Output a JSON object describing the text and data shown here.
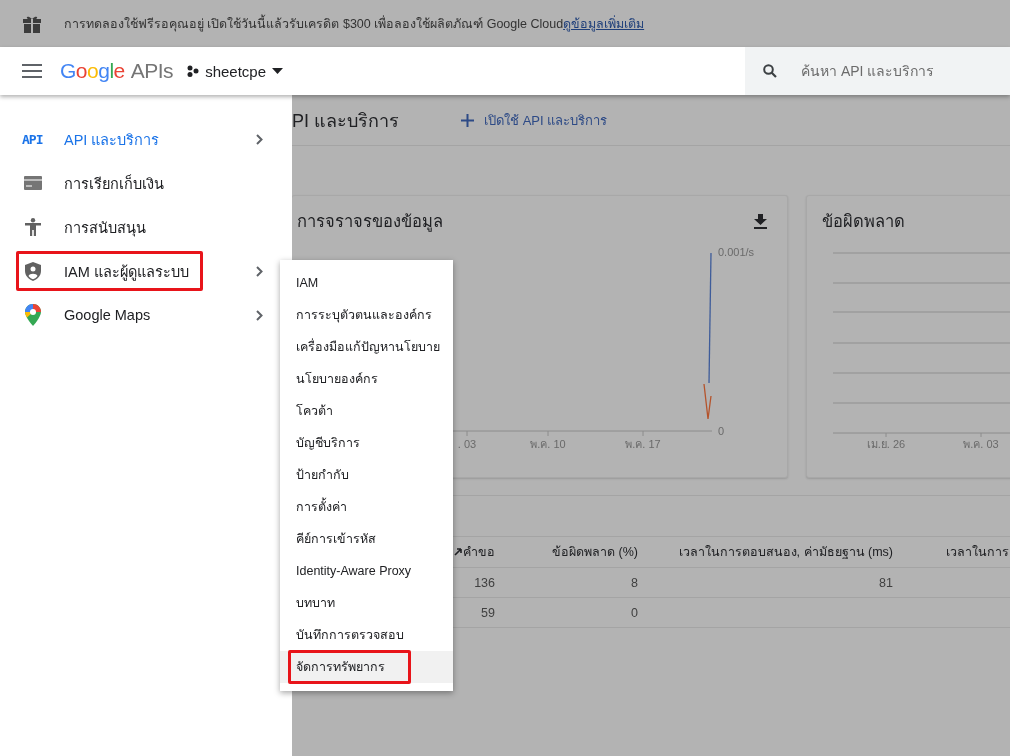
{
  "banner": {
    "text": "การทดลองใช้ฟรีรอคุณอยู่ เปิดใช้วันนี้แล้วรับเครดิต $300 เพื่อลองใช้ผลิตภัณฑ์ Google Cloud",
    "link": "ดูข้อมูลเพิ่มเติม"
  },
  "header": {
    "brand": "Google",
    "product": "APIs",
    "project": "sheetcpe",
    "search": {
      "placeholder": "ค้นหา API และบริการ"
    }
  },
  "sidebar": {
    "items": [
      {
        "kind": "api",
        "icon_text": "API",
        "label": "API และบริการ",
        "selected": true,
        "has_submenu": true,
        "highlighted": false
      },
      {
        "kind": "billing",
        "label": "การเรียกเก็บเงิน",
        "selected": false,
        "has_submenu": false,
        "highlighted": false
      },
      {
        "kind": "support",
        "label": "การสนับสนุน",
        "selected": false,
        "has_submenu": false,
        "highlighted": false
      },
      {
        "kind": "iam",
        "label": "IAM และผู้ดูแลระบบ",
        "selected": false,
        "has_submenu": true,
        "highlighted": true
      },
      {
        "kind": "maps",
        "label": "Google Maps",
        "selected": false,
        "has_submenu": true,
        "highlighted": false
      }
    ]
  },
  "submenu": {
    "items": [
      {
        "label": "IAM",
        "hovered": false,
        "highlighted": false
      },
      {
        "label": "การระบุตัวตนและองค์กร",
        "hovered": false,
        "highlighted": false
      },
      {
        "label": "เครื่องมือแก้ปัญหานโยบาย",
        "hovered": false,
        "highlighted": false
      },
      {
        "label": "นโยบายองค์กร",
        "hovered": false,
        "highlighted": false
      },
      {
        "label": "โควต้า",
        "hovered": false,
        "highlighted": false
      },
      {
        "label": "บัญชีบริการ",
        "hovered": false,
        "highlighted": false
      },
      {
        "label": "ป้ายกำกับ",
        "hovered": false,
        "highlighted": false
      },
      {
        "label": "การตั้งค่า",
        "hovered": false,
        "highlighted": false
      },
      {
        "label": "คีย์การเข้ารหัส",
        "hovered": false,
        "highlighted": false
      },
      {
        "label": "Identity-Aware Proxy",
        "hovered": false,
        "highlighted": false
      },
      {
        "label": "บทบาท",
        "hovered": false,
        "highlighted": false
      },
      {
        "label": "บันทึกการตรวจสอบ",
        "hovered": false,
        "highlighted": false
      },
      {
        "label": "จัดการทรัพยากร",
        "hovered": true,
        "highlighted": true
      }
    ]
  },
  "page": {
    "title": "PI และบริการ",
    "enable_button": "เปิดใช้ API และบริการ"
  },
  "traffic_card": {
    "title": "การจราจรของข้อมูล",
    "y_labels": [
      "0.001/s",
      "0"
    ],
    "x_labels": [
      ". 03",
      "พ.ค. 10",
      "พ.ค. 17"
    ]
  },
  "errors_card": {
    "title": "ข้อผิดพลาด",
    "x_labels": [
      "เม.ย. 26",
      "พ.ค. 03"
    ]
  },
  "table": {
    "columns": [
      "คำขอ",
      "ข้อผิดพลาด (%)",
      "เวลาในการตอบสนอง, ค่ามัธยฐาน (ms)",
      "เวลาในการ"
    ],
    "rows": [
      [
        "136",
        "8",
        "81"
      ],
      [
        "59",
        "0"
      ]
    ]
  }
}
